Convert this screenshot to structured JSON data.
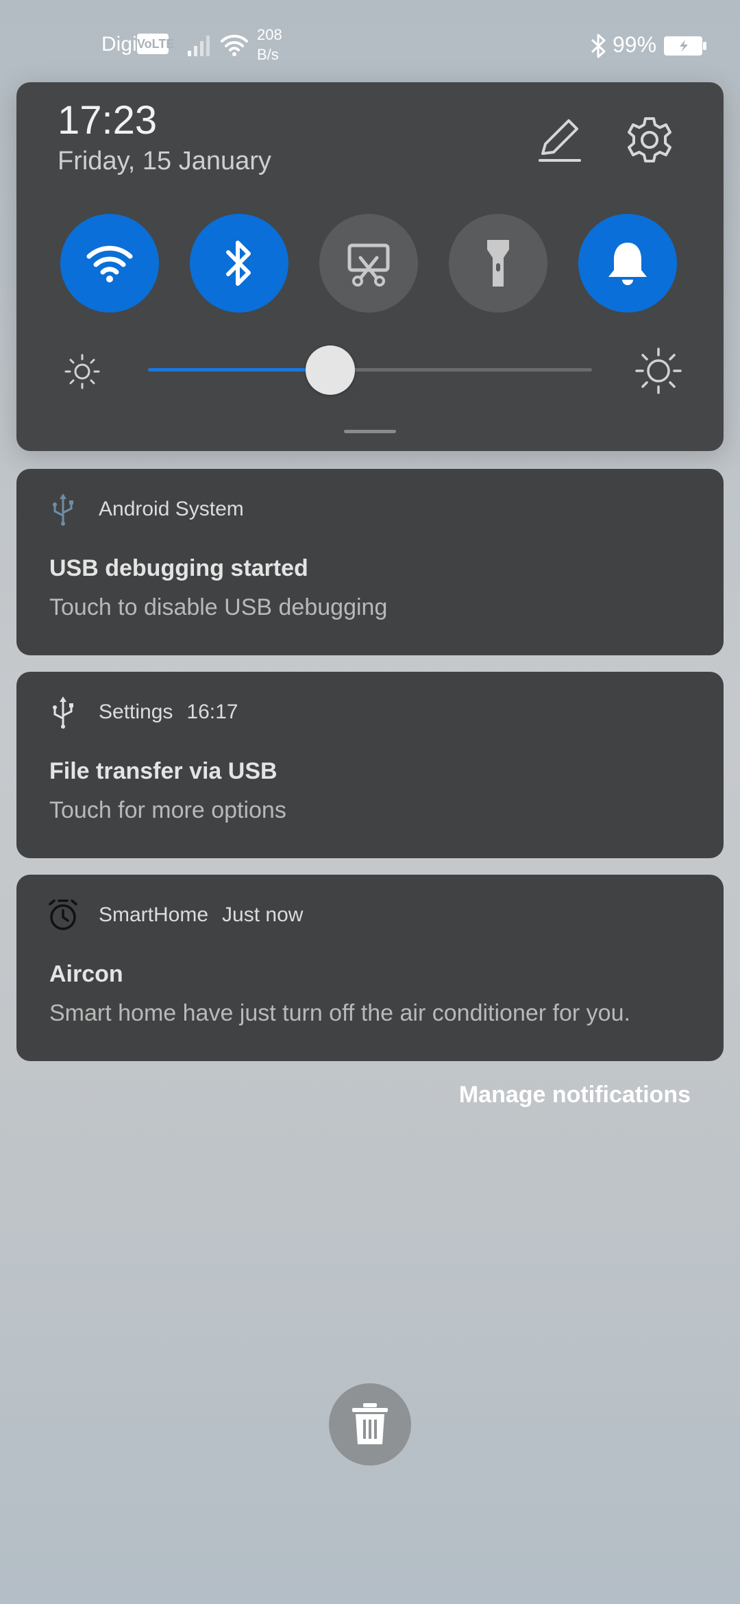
{
  "status_bar": {
    "carrier": "Digi",
    "volte_badge": "VoLTE",
    "net_speed_value": "208",
    "net_speed_unit": "B/s",
    "battery_percent": "99%"
  },
  "quick_settings": {
    "time": "17:23",
    "date": "Friday, 15 January",
    "tiles": [
      {
        "icon": "wifi-icon",
        "state": "on"
      },
      {
        "icon": "bluetooth-icon",
        "state": "on"
      },
      {
        "icon": "screenshot-icon",
        "state": "off"
      },
      {
        "icon": "flashlight-icon",
        "state": "off"
      },
      {
        "icon": "bell-icon",
        "state": "on"
      }
    ],
    "brightness_level": 0.41,
    "accent_color": "#0a6fd8"
  },
  "notifications": [
    {
      "app": "Android System",
      "time": "",
      "icon": "usb-icon",
      "title": "USB debugging started",
      "body": "Touch to disable USB debugging"
    },
    {
      "app": "Settings",
      "time": "16:17",
      "icon": "usb-icon",
      "title": "File transfer via USB",
      "body": "Touch for more options"
    },
    {
      "app": "SmartHome",
      "time": "Just now",
      "icon": "alarm-clock-icon",
      "title": "Aircon",
      "body": "Smart home have just turn off the air conditioner for you."
    }
  ],
  "manage_label": "Manage notifications",
  "clear_icon": "trash-icon"
}
